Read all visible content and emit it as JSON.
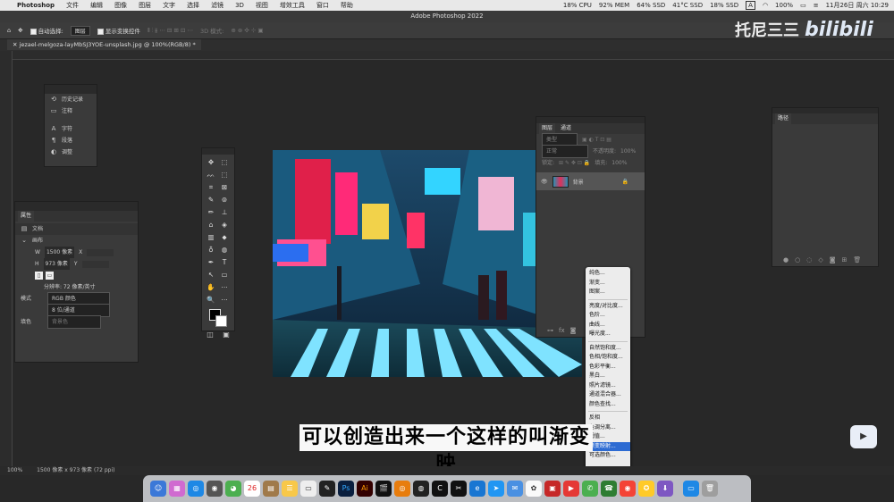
{
  "macbar": {
    "app": "Photoshop",
    "menus": [
      "文件",
      "编辑",
      "图像",
      "图层",
      "文字",
      "选择",
      "滤镜",
      "3D",
      "视图",
      "增效工具",
      "窗口",
      "帮助"
    ],
    "stats": [
      "18% CPU",
      "92% MEM",
      "64% SSD",
      "41°C SSD",
      "18% SSD"
    ],
    "input_badge": "A",
    "battery": "100%",
    "datetime": "11月26日 周六 10:29"
  },
  "titlebar": {
    "title": "Adobe Photoshop 2022"
  },
  "optbar": {
    "auto_select_label": "自动选择:",
    "auto_select_value": "图层",
    "show_transform": "显示变换控件",
    "mode3d": "3D 模式:"
  },
  "doctab": {
    "title": "jezael-melgoza-layMbSJ3YOE-unsplash.jpg @ 100%(RGB/8) *"
  },
  "history_panel": {
    "items": [
      {
        "icon": "history-icon",
        "glyph": "⟲",
        "label": "历史记录"
      },
      {
        "icon": "comment-icon",
        "glyph": "▭",
        "label": "注释"
      },
      {
        "icon": "character-icon",
        "glyph": "A",
        "label": "字符"
      },
      {
        "icon": "paragraph-icon",
        "glyph": "¶",
        "label": "段落"
      },
      {
        "icon": "adjust-icon",
        "glyph": "◐",
        "label": "调整"
      }
    ]
  },
  "properties_panel": {
    "tab": "属性",
    "doc_label": "文档",
    "section": "画布",
    "w_label": "W",
    "w_value": "1500 像素",
    "h_label": "H",
    "h_value": "973 像素",
    "x_label": "X",
    "y_label": "Y",
    "resolution": "分辨率: 72 像素/英寸",
    "mode_label": "模式",
    "mode_value": "RGB 颜色",
    "depth_value": "8 位/通道",
    "fill_label": "填色",
    "fill_value": "背景色"
  },
  "layers_panel": {
    "tabs": [
      "图层",
      "通道"
    ],
    "filter_kind": "类型",
    "blend_mode": "正常",
    "opacity_label": "不透明度:",
    "opacity_value": "100%",
    "lock_label": "锁定:",
    "fill_label": "填充:",
    "fill_value": "100%",
    "layer_name": "背景"
  },
  "paths_panel": {
    "tab": "路径"
  },
  "adjust_menu": {
    "groups": [
      [
        "纯色...",
        "渐变...",
        "图案..."
      ],
      [
        "亮度/对比度...",
        "色阶...",
        "曲线...",
        "曝光度..."
      ],
      [
        "自然饱和度...",
        "色相/饱和度...",
        "色彩平衡...",
        "黑白...",
        "照片滤镜...",
        "通道混合器...",
        "颜色查找..."
      ],
      [
        "反相",
        "色调分离...",
        "阈值...",
        "渐变映射...",
        "可选颜色..."
      ]
    ],
    "highlight": "渐变映射..."
  },
  "subtitle": {
    "text": "可以创造出来一个这样的叫渐变映"
  },
  "status": {
    "zoom": "100%",
    "info": "1500 像素 x 973 像素 (72 ppi)"
  },
  "watermark": {
    "name": "托尼三三",
    "brand": "bilibili"
  },
  "dock": {
    "calendar_day": "26"
  },
  "tools": [
    "✥",
    "⬚",
    "ᨓ",
    "⬚",
    "⌗",
    "⊠",
    "✎",
    "⊚",
    "✏",
    "⊥",
    "⌂",
    "◈",
    "▥",
    "⬥",
    "♁",
    "◍",
    "✒",
    "T",
    "↖",
    "▭",
    "✋",
    "⋯",
    "🔍",
    "⋯"
  ]
}
